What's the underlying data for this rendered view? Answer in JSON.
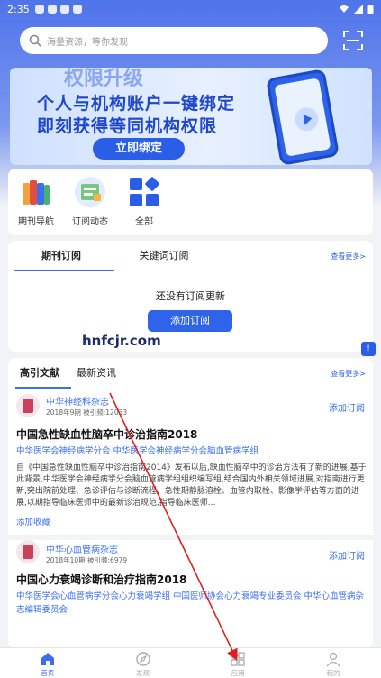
{
  "status": {
    "time": "2:35"
  },
  "search": {
    "placeholder": "海量资源，等你发现"
  },
  "banner": {
    "top_text": "权限升级",
    "line1": "个人与机构账户一键绑定",
    "line2": "即刻获得等同机构权限",
    "button": "立即绑定"
  },
  "quick_menu": [
    {
      "label": "期刊导航",
      "icon": "journal-books-icon"
    },
    {
      "label": "订阅动态",
      "icon": "subscription-icon"
    },
    {
      "label": "全部",
      "icon": "all-grid-icon"
    }
  ],
  "subscription": {
    "tabs": [
      "期刊订阅",
      "关键词订阅"
    ],
    "more": "查看更多>",
    "empty": "还没有订阅更新",
    "button": "添加订阅"
  },
  "watermark": "hnfcjr.com",
  "feed": {
    "tabs": [
      "高引文献",
      "最新资讯"
    ],
    "more": "查看更多>",
    "articles": [
      {
        "journal": "中华神经科杂志",
        "meta": "2018年9期    被引频:12033",
        "add": "添加订阅",
        "title": "中国急性缺血性脑卒中诊治指南2018",
        "authors": "中华医学会神经病学分会  中华医学会神经病学分会脑血管病学组",
        "abstract": "自《中国急性缺血性脑卒中诊治指南2014》发布以后,缺血性脑卒中的诊治方法有了新的进展,基于此背景,中华医学会神经病学分会脑血管病学组组织编写组,结合国内外相关领域进展,对指南进行更新,突出院前处理、急诊评估与诊断流程、急性期静脉溶栓、血管内取栓、影像学评估等方面的进展,以期指导临床医师中的最新诊治规范,指导临床医师...",
        "fav": "添加收藏"
      },
      {
        "journal": "中华心血管病杂志",
        "meta": "2018年10期    被引频:6979",
        "add": "添加订阅",
        "title": "中国心力衰竭诊断和治疗指南2018",
        "authors": "中华医学会心血管病学分会心力衰竭学组  中国医师协会心力衰竭专业委员会  中华心血管病杂志编辑委员会",
        "abstract": "",
        "fav": ""
      }
    ]
  },
  "bottom_nav": [
    {
      "label": "首页",
      "icon": "home-icon",
      "active": true
    },
    {
      "label": "发现",
      "icon": "discover-icon",
      "active": false
    },
    {
      "label": "应用",
      "icon": "apps-icon",
      "active": false
    },
    {
      "label": "我的",
      "icon": "profile-icon",
      "active": false
    }
  ],
  "colors": {
    "accent": "#2b5ee6",
    "header": "#4f74ea"
  }
}
